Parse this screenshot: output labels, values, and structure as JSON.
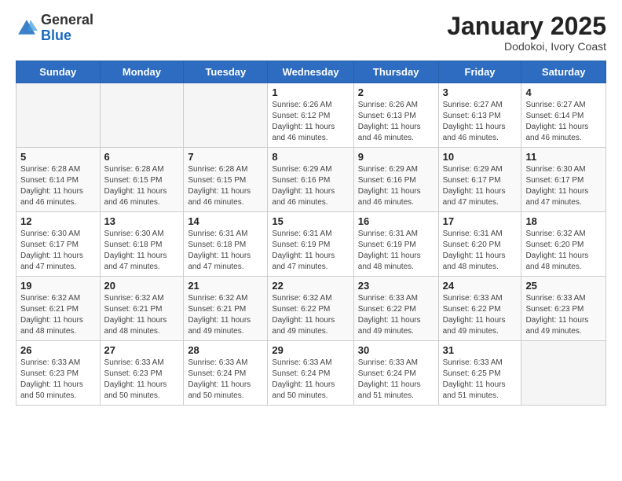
{
  "header": {
    "logo_general": "General",
    "logo_blue": "Blue",
    "month_title": "January 2025",
    "subtitle": "Dodokoi, Ivory Coast"
  },
  "days_of_week": [
    "Sunday",
    "Monday",
    "Tuesday",
    "Wednesday",
    "Thursday",
    "Friday",
    "Saturday"
  ],
  "weeks": [
    [
      {
        "day": "",
        "info": ""
      },
      {
        "day": "",
        "info": ""
      },
      {
        "day": "",
        "info": ""
      },
      {
        "day": "1",
        "info": "Sunrise: 6:26 AM\nSunset: 6:12 PM\nDaylight: 11 hours and 46 minutes."
      },
      {
        "day": "2",
        "info": "Sunrise: 6:26 AM\nSunset: 6:13 PM\nDaylight: 11 hours and 46 minutes."
      },
      {
        "day": "3",
        "info": "Sunrise: 6:27 AM\nSunset: 6:13 PM\nDaylight: 11 hours and 46 minutes."
      },
      {
        "day": "4",
        "info": "Sunrise: 6:27 AM\nSunset: 6:14 PM\nDaylight: 11 hours and 46 minutes."
      }
    ],
    [
      {
        "day": "5",
        "info": "Sunrise: 6:28 AM\nSunset: 6:14 PM\nDaylight: 11 hours and 46 minutes."
      },
      {
        "day": "6",
        "info": "Sunrise: 6:28 AM\nSunset: 6:15 PM\nDaylight: 11 hours and 46 minutes."
      },
      {
        "day": "7",
        "info": "Sunrise: 6:28 AM\nSunset: 6:15 PM\nDaylight: 11 hours and 46 minutes."
      },
      {
        "day": "8",
        "info": "Sunrise: 6:29 AM\nSunset: 6:16 PM\nDaylight: 11 hours and 46 minutes."
      },
      {
        "day": "9",
        "info": "Sunrise: 6:29 AM\nSunset: 6:16 PM\nDaylight: 11 hours and 46 minutes."
      },
      {
        "day": "10",
        "info": "Sunrise: 6:29 AM\nSunset: 6:17 PM\nDaylight: 11 hours and 47 minutes."
      },
      {
        "day": "11",
        "info": "Sunrise: 6:30 AM\nSunset: 6:17 PM\nDaylight: 11 hours and 47 minutes."
      }
    ],
    [
      {
        "day": "12",
        "info": "Sunrise: 6:30 AM\nSunset: 6:17 PM\nDaylight: 11 hours and 47 minutes."
      },
      {
        "day": "13",
        "info": "Sunrise: 6:30 AM\nSunset: 6:18 PM\nDaylight: 11 hours and 47 minutes."
      },
      {
        "day": "14",
        "info": "Sunrise: 6:31 AM\nSunset: 6:18 PM\nDaylight: 11 hours and 47 minutes."
      },
      {
        "day": "15",
        "info": "Sunrise: 6:31 AM\nSunset: 6:19 PM\nDaylight: 11 hours and 47 minutes."
      },
      {
        "day": "16",
        "info": "Sunrise: 6:31 AM\nSunset: 6:19 PM\nDaylight: 11 hours and 48 minutes."
      },
      {
        "day": "17",
        "info": "Sunrise: 6:31 AM\nSunset: 6:20 PM\nDaylight: 11 hours and 48 minutes."
      },
      {
        "day": "18",
        "info": "Sunrise: 6:32 AM\nSunset: 6:20 PM\nDaylight: 11 hours and 48 minutes."
      }
    ],
    [
      {
        "day": "19",
        "info": "Sunrise: 6:32 AM\nSunset: 6:21 PM\nDaylight: 11 hours and 48 minutes."
      },
      {
        "day": "20",
        "info": "Sunrise: 6:32 AM\nSunset: 6:21 PM\nDaylight: 11 hours and 48 minutes."
      },
      {
        "day": "21",
        "info": "Sunrise: 6:32 AM\nSunset: 6:21 PM\nDaylight: 11 hours and 49 minutes."
      },
      {
        "day": "22",
        "info": "Sunrise: 6:32 AM\nSunset: 6:22 PM\nDaylight: 11 hours and 49 minutes."
      },
      {
        "day": "23",
        "info": "Sunrise: 6:33 AM\nSunset: 6:22 PM\nDaylight: 11 hours and 49 minutes."
      },
      {
        "day": "24",
        "info": "Sunrise: 6:33 AM\nSunset: 6:22 PM\nDaylight: 11 hours and 49 minutes."
      },
      {
        "day": "25",
        "info": "Sunrise: 6:33 AM\nSunset: 6:23 PM\nDaylight: 11 hours and 49 minutes."
      }
    ],
    [
      {
        "day": "26",
        "info": "Sunrise: 6:33 AM\nSunset: 6:23 PM\nDaylight: 11 hours and 50 minutes."
      },
      {
        "day": "27",
        "info": "Sunrise: 6:33 AM\nSunset: 6:23 PM\nDaylight: 11 hours and 50 minutes."
      },
      {
        "day": "28",
        "info": "Sunrise: 6:33 AM\nSunset: 6:24 PM\nDaylight: 11 hours and 50 minutes."
      },
      {
        "day": "29",
        "info": "Sunrise: 6:33 AM\nSunset: 6:24 PM\nDaylight: 11 hours and 50 minutes."
      },
      {
        "day": "30",
        "info": "Sunrise: 6:33 AM\nSunset: 6:24 PM\nDaylight: 11 hours and 51 minutes."
      },
      {
        "day": "31",
        "info": "Sunrise: 6:33 AM\nSunset: 6:25 PM\nDaylight: 11 hours and 51 minutes."
      },
      {
        "day": "",
        "info": ""
      }
    ]
  ]
}
